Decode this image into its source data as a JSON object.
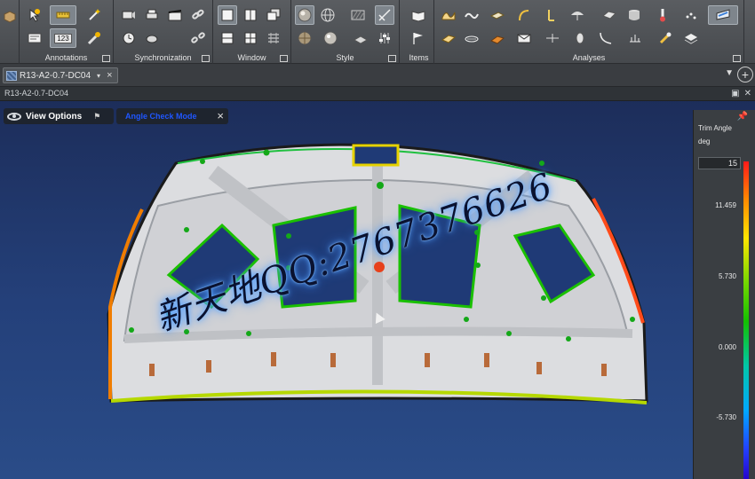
{
  "ribbon": {
    "groups": [
      {
        "label": "Annotations"
      },
      {
        "label": "Synchronization"
      },
      {
        "label": "Window"
      },
      {
        "label": "Style"
      },
      {
        "label": "Items"
      },
      {
        "label": "Analyses"
      }
    ],
    "counter_badge": "123"
  },
  "tabs": {
    "active_doc": "R13-A2-0.7-DC04",
    "menu_glyph": "▾",
    "close_glyph": "×"
  },
  "viewport": {
    "title": "R13-A2-0.7-DC04",
    "view_options_label": "View Options",
    "mode_label": "Angle Check Mode",
    "mode_close": "×"
  },
  "overlay": {
    "watermark": "新天地QQ:2767376626"
  },
  "legend": {
    "title": "Trim Angle",
    "unit": "deg",
    "max_value": "15",
    "ticks": [
      "11.459",
      "5.730",
      "0.000",
      "-5.730"
    ],
    "colors": [
      "#ff1a1a",
      "#ffe500",
      "#14c000",
      "#00a8ff",
      "#2600c9"
    ]
  },
  "colors": {
    "ribbon_bg": "#4f5256",
    "viewport_bg": "#24407a",
    "mode_label": "#1f56ff"
  }
}
